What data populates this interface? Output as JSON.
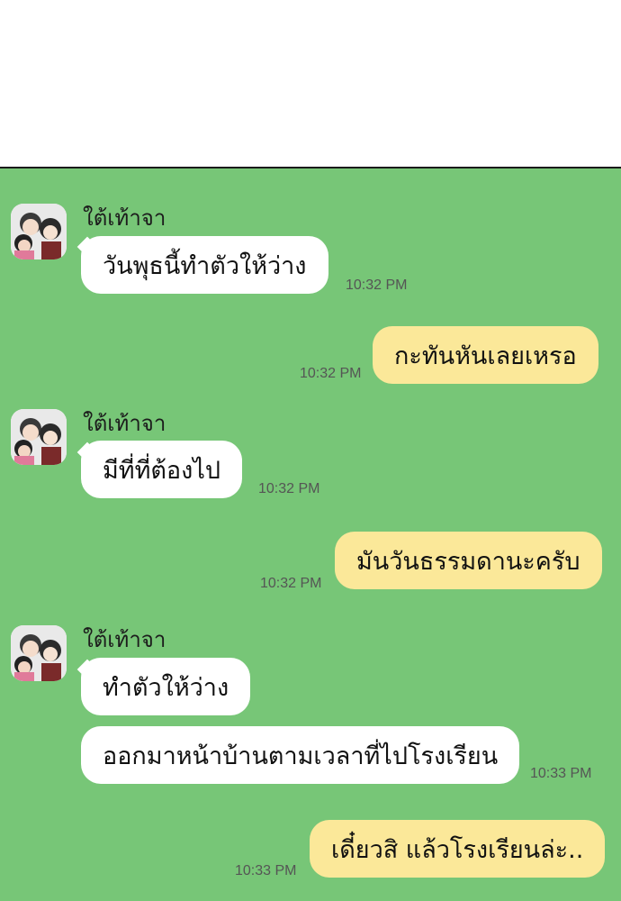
{
  "chat": {
    "messages": [
      {
        "sender": "ใต้เท้าจา",
        "text": "วันพุธนี้ทำตัวให้ว่าง",
        "time": "10:32 PM"
      },
      {
        "text": "กะทันหันเลยเหรอ",
        "time": "10:32 PM"
      },
      {
        "sender": "ใต้เท้าจา",
        "text": "มีที่ที่ต้องไป",
        "time": "10:32 PM"
      },
      {
        "text": "มันวันธรรมดานะครับ",
        "time": "10:32 PM"
      },
      {
        "sender": "ใต้เท้าจา",
        "text": "ทำตัวให้ว่าง"
      },
      {
        "text": "ออกมาหน้าบ้านตามเวลาที่ไปโรงเรียน",
        "time": "10:33 PM"
      },
      {
        "text": "เดี๋ยวสิ แล้วโรงเรียนล่ะ..",
        "time": "10:33 PM"
      }
    ]
  },
  "colors": {
    "chat_background": "#77c677",
    "incoming_bubble": "#ffffff",
    "outgoing_bubble": "#fbe899"
  }
}
